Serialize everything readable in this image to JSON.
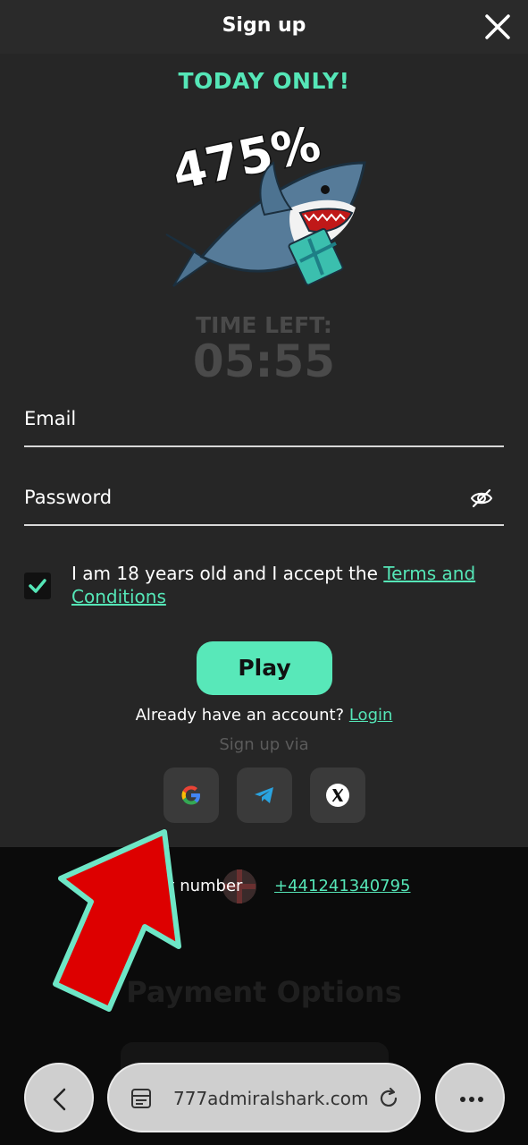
{
  "header": {
    "title": "Sign up"
  },
  "promo": {
    "headline": "TODAY ONLY!",
    "bonus_percent": "475%",
    "timer_label": "TIME LEFT:",
    "timer_value": "05:55"
  },
  "form": {
    "email_label": "Email",
    "password_label": "Password",
    "agree_text": "I am 18 years old and I accept the ",
    "terms_link": "Terms and Conditions",
    "terms_checked": true,
    "play_button": "Play",
    "have_account_text": "Already have an account? ",
    "login_link": "Login",
    "signup_via": "Sign up via"
  },
  "social": [
    {
      "name": "google-icon"
    },
    {
      "name": "telegram-icon"
    },
    {
      "name": "x-icon"
    }
  ],
  "footer": {
    "support_label": "ort number",
    "support_number": "+441241340795",
    "payment_title": "Payment Options"
  },
  "browser": {
    "url": "777admiralshark.com"
  },
  "colors": {
    "accent": "#55e6b7",
    "arrow": "#dd0000",
    "arrow_outline": "#6ee6c6"
  }
}
